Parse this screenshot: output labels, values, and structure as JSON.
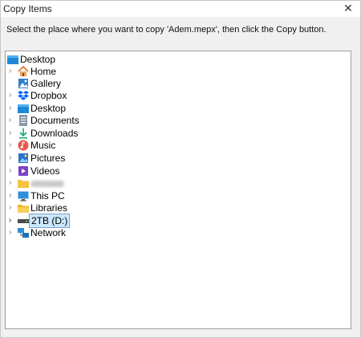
{
  "window": {
    "title": "Copy Items",
    "close_glyph": "✕"
  },
  "instructions": "Select the place where you want to copy 'Adem.mepx', then click the Copy button.",
  "tree": {
    "root": {
      "label": "Desktop",
      "icon": "desktop-folder-icon"
    },
    "items": [
      {
        "label": "Home",
        "icon": "home-icon"
      },
      {
        "label": "Gallery",
        "icon": "gallery-icon"
      },
      {
        "label": "Dropbox",
        "icon": "dropbox-icon"
      },
      {
        "label": "Desktop",
        "icon": "desktop-folder-icon"
      },
      {
        "label": "Documents",
        "icon": "documents-icon"
      },
      {
        "label": "Downloads",
        "icon": "downloads-icon"
      },
      {
        "label": "Music",
        "icon": "music-icon"
      },
      {
        "label": "Pictures",
        "icon": "pictures-icon"
      },
      {
        "label": "Videos",
        "icon": "videos-icon"
      },
      {
        "label": "",
        "icon": "folder-icon"
      },
      {
        "label": "This PC",
        "icon": "this-pc-icon"
      },
      {
        "label": "Libraries",
        "icon": "libraries-icon"
      },
      {
        "label": "2TB (D:)",
        "icon": "drive-icon",
        "selected": true
      },
      {
        "label": "Network",
        "icon": "network-icon"
      }
    ]
  },
  "colors": {
    "accent_blue": "#1e88d6",
    "selection_bg": "#cce8ff",
    "selection_border": "#7da2ce"
  }
}
